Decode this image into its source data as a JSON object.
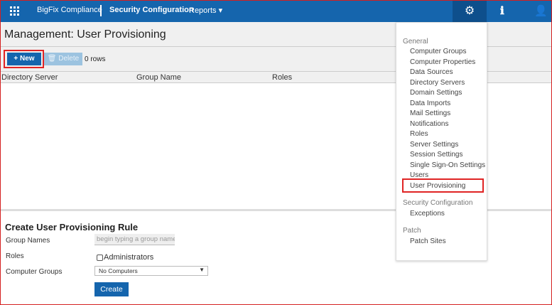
{
  "header": {
    "brand": "BigFix Compliance",
    "section": "Security Configuration",
    "reports": "Reports ▾",
    "icons": [
      "apps-grid-icon",
      "gear-icon",
      "info-icon",
      "user-icon"
    ]
  },
  "page": {
    "title": "Management: User Provisioning"
  },
  "toolbar": {
    "new": "+ New",
    "delete": "🗑 Delete",
    "rows": "0 rows"
  },
  "table": {
    "columns": [
      "Directory Server",
      "Group Name",
      "Roles"
    ]
  },
  "form": {
    "title": "Create User Provisioning Rule",
    "group_names_label": "Group Names",
    "group_names_placeholder": "begin typing a group name",
    "roles_label": "Roles",
    "roles_option": "Administrators",
    "computer_groups_label": "Computer Groups",
    "computer_groups_value": "No Computers",
    "create": "Create"
  },
  "menu": {
    "general": "General",
    "general_items": [
      "Computer Groups",
      "Computer Properties",
      "Data Sources",
      "Directory Servers",
      "Domain Settings",
      "Data Imports",
      "Mail Settings",
      "Notifications",
      "Roles",
      "Server Settings",
      "Session Settings",
      "Single Sign-On Settings",
      "Users",
      "User Provisioning"
    ],
    "security": "Security Configuration",
    "security_items": [
      "Exceptions"
    ],
    "patch": "Patch",
    "patch_items": [
      "Patch Sites"
    ]
  }
}
